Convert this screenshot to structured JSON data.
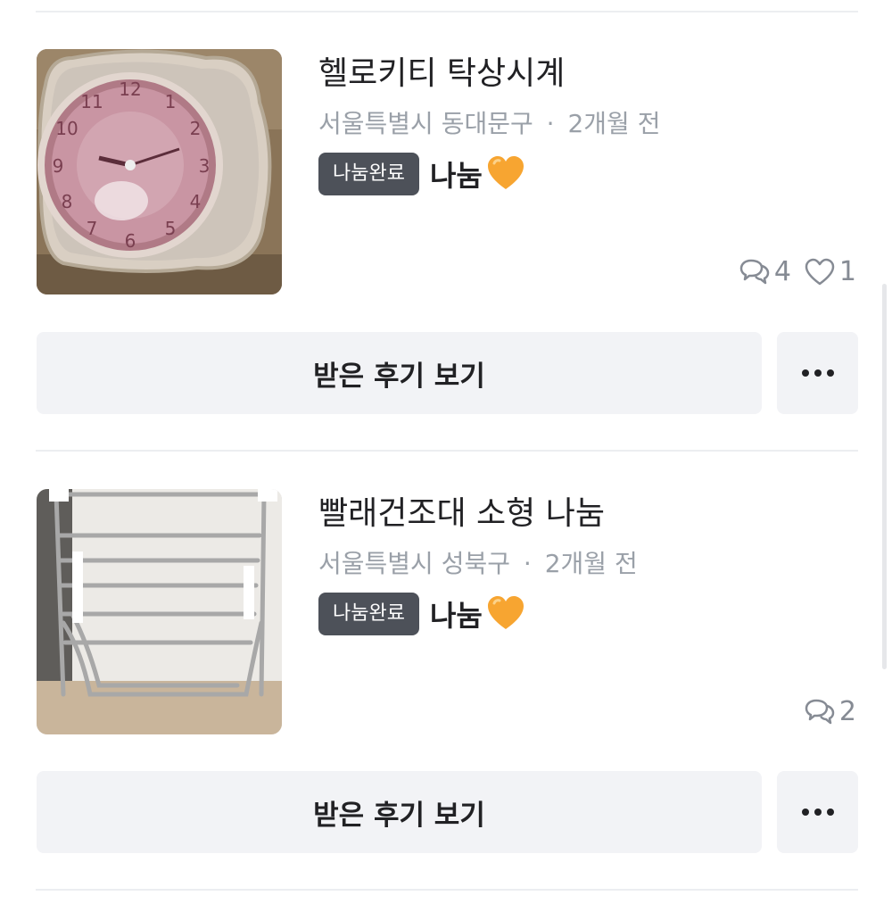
{
  "items": [
    {
      "title": "헬로키티 탁상시계",
      "location": "서울특별시 동대문구",
      "separator": "·",
      "time": "2개월 전",
      "badge": "나눔완료",
      "price": "나눔",
      "chat_count": "4",
      "like_count": "1",
      "review_label": "받은 후기 보기",
      "thumbnail_icon": "pink-alarm-clock-photo"
    },
    {
      "title": "빨래건조대 소형 나눔",
      "location": "서울특별시 성북구",
      "separator": "·",
      "time": "2개월 전",
      "badge": "나눔완료",
      "price": "나눔",
      "chat_count": "2",
      "review_label": "받은 후기 보기",
      "thumbnail_icon": "drying-rack-photo"
    }
  ],
  "icons": {
    "chat": "chat-bubbles-icon",
    "like": "heart-outline-icon",
    "more": "more-dots-icon",
    "heart_emoji": "orange-heart-emoji"
  },
  "colors": {
    "badge_bg": "#4d5159",
    "button_bg": "#f2f3f6",
    "meta_text": "#9aa0a8",
    "heart": "#f7a531"
  }
}
